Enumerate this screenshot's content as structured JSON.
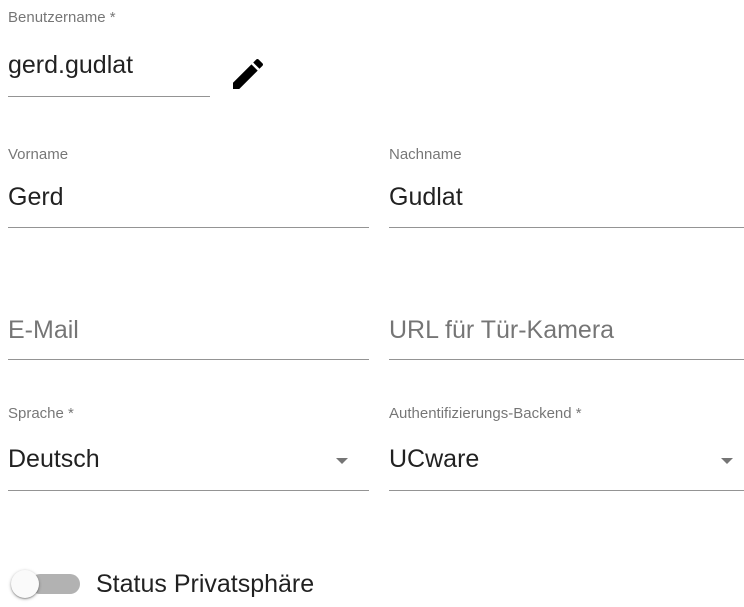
{
  "form": {
    "username": {
      "label": "Benutzername *",
      "value": "gerd.gudlat"
    },
    "edit_icon": "pencil-icon",
    "firstname": {
      "label": "Vorname",
      "value": "Gerd"
    },
    "lastname": {
      "label": "Nachname",
      "value": "Gudlat"
    },
    "email": {
      "placeholder": "E-Mail",
      "value": ""
    },
    "door_camera_url": {
      "placeholder": "URL für Tür-Kamera",
      "value": ""
    },
    "language": {
      "label": "Sprache *",
      "value": "Deutsch"
    },
    "auth_backend": {
      "label": "Authentifizierungs-Backend *",
      "value": "UCware"
    },
    "privacy_status": {
      "label": "Status Privatsphäre",
      "checked": false
    }
  },
  "colors": {
    "text_primary": "#212121",
    "text_secondary": "#757575",
    "underline": "#949494",
    "toggle_track_off": "#b2b2b2",
    "toggle_thumb_off": "#fafafa"
  }
}
